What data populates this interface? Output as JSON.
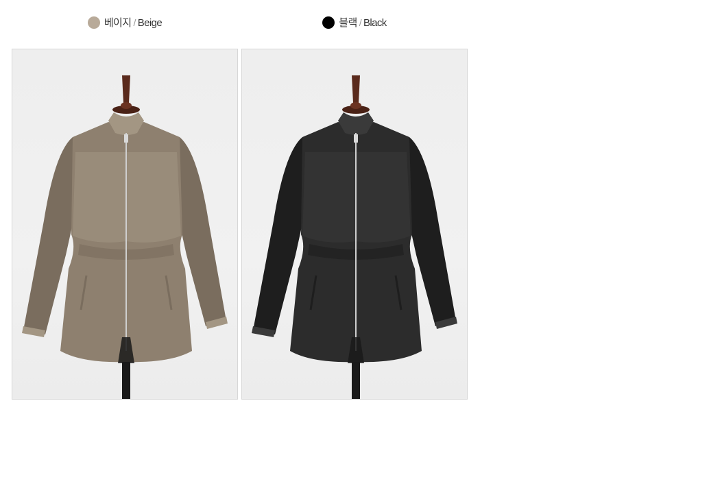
{
  "variants": [
    {
      "name_ko": "베이지",
      "separator": "/",
      "name_en": "Beige",
      "swatch_color": "#b8aa99",
      "coat_color": "#8e806f",
      "coat_shade": "#7a6d5e",
      "coat_light": "#a39683"
    },
    {
      "name_ko": "블랙",
      "separator": "/",
      "name_en": "Black",
      "swatch_color": "#000000",
      "coat_color": "#2c2c2c",
      "coat_shade": "#1e1e1e",
      "coat_light": "#3a3a3a"
    }
  ],
  "icons": {
    "mannequin": "mannequin-icon",
    "swatch": "color-swatch-icon"
  }
}
